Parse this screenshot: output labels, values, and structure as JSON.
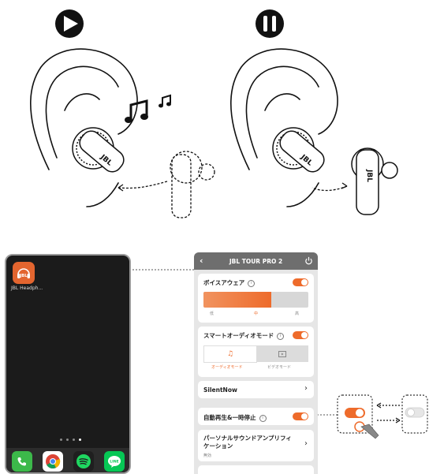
{
  "app": {
    "title": "JBL TOUR PRO 2",
    "voice_aware": {
      "label": "ボイスアウェア",
      "levels": [
        "低",
        "中",
        "高"
      ],
      "level": 0.65,
      "enabled": true
    },
    "smart_audio": {
      "label": "スマートオーディオモード",
      "modes": [
        "オーディオモード",
        "ビデオモード"
      ],
      "selected": "オーディオモード",
      "enabled": true
    },
    "silent_now": {
      "label": "SilentNow"
    },
    "auto_play_pause": {
      "label": "自動再生&一時停止",
      "enabled": true
    },
    "personal_sound": {
      "label": "パーソナルサウンドアンプリフィケーション",
      "sub": "無効"
    }
  },
  "phone": {
    "app_label": "JBL Headph...",
    "app_icon_text": "JBL",
    "dock_icons": [
      "phone-icon",
      "chrome-icon",
      "spotify-icon",
      "line-icon"
    ],
    "line_text": "LINE"
  },
  "colors": {
    "accent": "#ee6b2b",
    "header": "#6e6e6e"
  }
}
